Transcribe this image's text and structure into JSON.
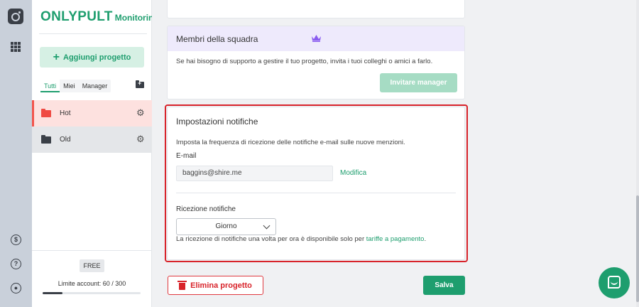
{
  "brand": {
    "name": "ONLYPULT",
    "product": "Monitoring"
  },
  "sidebar": {
    "add_project": "Aggiungi progetto",
    "filters": [
      "Tutti",
      "Miei",
      "Manager"
    ],
    "projects": [
      {
        "name": "Hot",
        "color": "#ef4a43"
      },
      {
        "name": "Old",
        "color": "#3a3f47"
      }
    ],
    "plan": "FREE",
    "limit_label": "Limite account: 60 / 300",
    "limit_used": 60,
    "limit_total": 300
  },
  "team": {
    "title": "Membri della squadra",
    "description": "Se hai bisogno di supporto a gestire il tuo progetto, invita i tuoi colleghi o amici a farlo.",
    "invite_button": "Invitare manager"
  },
  "notifications": {
    "title": "Impostazioni notifiche",
    "description": "Imposta la frequenza di ricezione delle notifiche e-mail sulle nuove menzioni.",
    "email_label": "E-mail",
    "email_value": "baggins@shire.me",
    "edit_link": "Modifica",
    "frequency_label": "Ricezione notifiche",
    "frequency_value": "Giorno",
    "note_prefix": "La ricezione di notifiche una volta per ora è disponibile solo per ",
    "note_link": "tariffe a pagamento",
    "note_suffix": "."
  },
  "actions": {
    "delete": "Elimina progetto",
    "save": "Salva"
  },
  "colors": {
    "accent": "#1e9e6e",
    "danger": "#d8232a",
    "highlight": "#d8232a"
  }
}
